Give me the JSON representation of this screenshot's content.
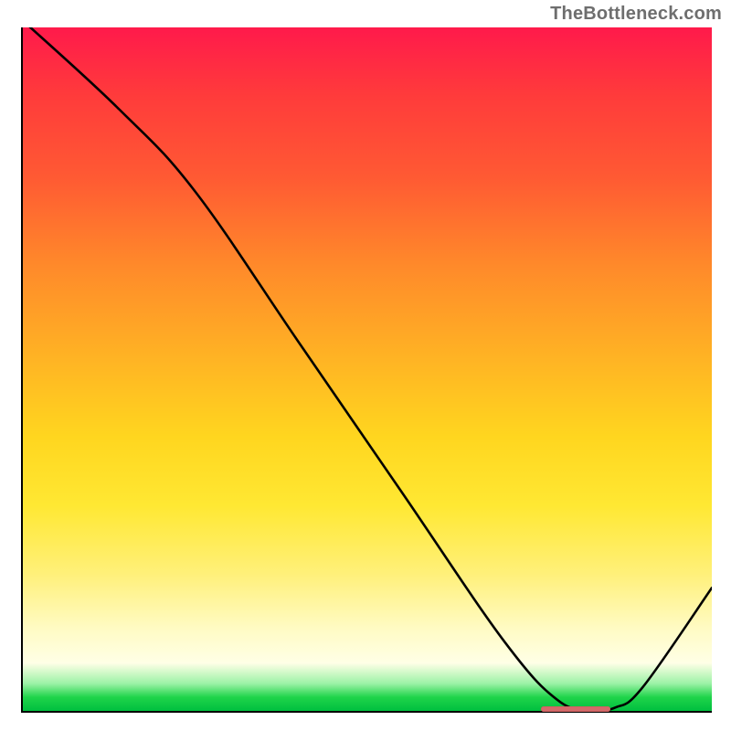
{
  "watermark": "TheBottleneck.com",
  "colors": {
    "gradient_top": "#ff1a4b",
    "gradient_bottom": "#00bf3f",
    "curve": "#000000",
    "marker": "#d46a6a",
    "axis": "#000000"
  },
  "chart_data": {
    "type": "line",
    "title": "",
    "xlabel": "",
    "ylabel": "",
    "xlim": [
      0,
      100
    ],
    "ylim": [
      0,
      100
    ],
    "series": [
      {
        "name": "bottleneck-curve",
        "x": [
          0,
          14,
          25,
          40,
          55,
          70,
          78,
          83,
          86,
          90,
          100
        ],
        "values": [
          101,
          88,
          76,
          54,
          32,
          10,
          1.3,
          0.4,
          0.5,
          3.5,
          18
        ]
      }
    ],
    "annotations": [
      {
        "name": "optimal-range",
        "x_start": 75,
        "x_end": 85,
        "y": 0.6
      }
    ]
  }
}
